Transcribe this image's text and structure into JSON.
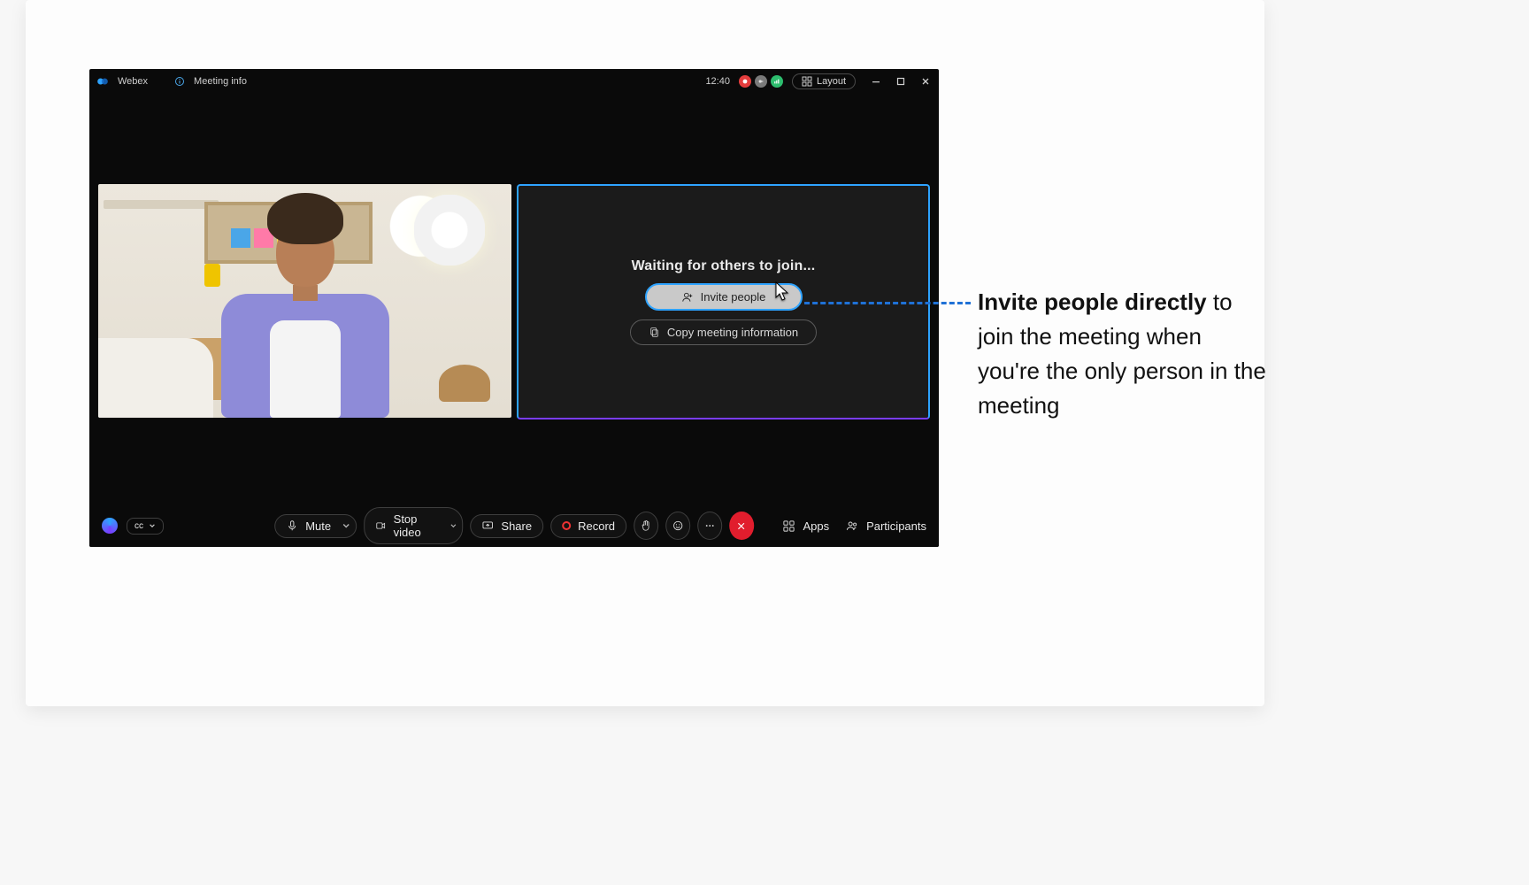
{
  "titlebar": {
    "app_name": "Webex",
    "meeting_info_label": "Meeting info",
    "clock": "12:40",
    "layout_label": "Layout"
  },
  "waiting": {
    "title": "Waiting for others to join...",
    "invite_label": "Invite people",
    "copy_label": "Copy meeting information"
  },
  "callout": {
    "bold": "Invite people directly",
    "rest": " to join the meeting when you're the only person in the meeting"
  },
  "toolbar": {
    "mute_label": "Mute",
    "stop_video_label": "Stop video",
    "share_label": "Share",
    "record_label": "Record",
    "apps_label": "Apps",
    "participants_label": "Participants",
    "cc_label": "cc"
  },
  "colors": {
    "accent_blue": "#2ea3ff",
    "accent_purple": "#7a3cff",
    "end_red": "#e11d2d",
    "rec_red": "#e43d3d",
    "net_green": "#2dbd6e"
  }
}
